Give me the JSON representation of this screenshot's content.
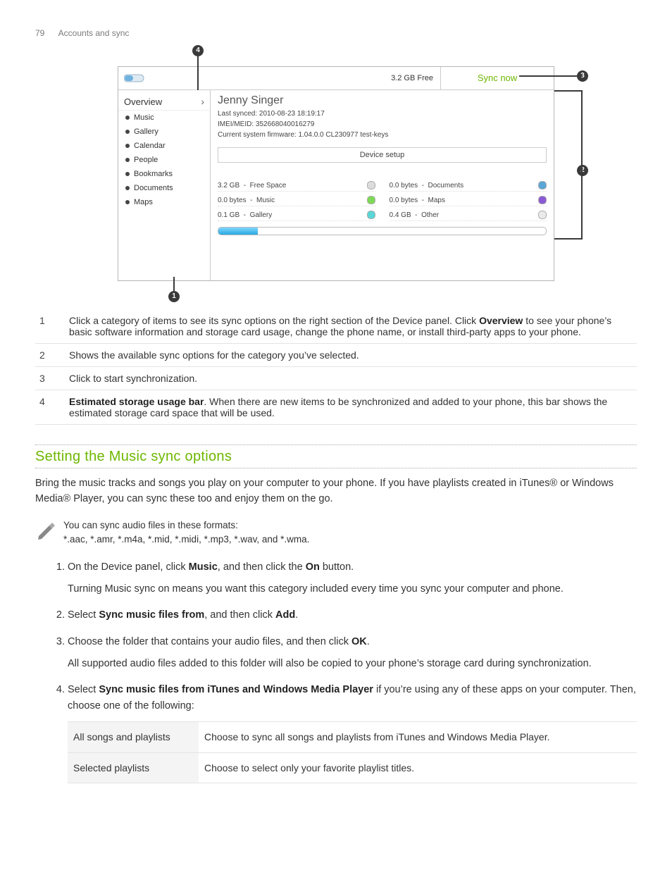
{
  "header": {
    "page": "79",
    "section": "Accounts and sync"
  },
  "callouts": {
    "c1": "1",
    "c2": "2",
    "c3": "3",
    "c4": "4"
  },
  "panel": {
    "free": "3.2 GB Free",
    "sync_now": "Sync now",
    "overview": "Overview",
    "side_items": [
      "Music",
      "Gallery",
      "Calendar",
      "People",
      "Bookmarks",
      "Documents",
      "Maps"
    ],
    "name": "Jenny Singer",
    "last_synced": "Last synced: 2010-08-23 18:19:17",
    "imei": "IMEI/MEID: 352668040016279",
    "firmware": "Current system firmware: 1.04.0.0 CL230977 test-keys",
    "device_setup": "Device setup",
    "storage": [
      {
        "size": "3.2 GB",
        "label": "Free Space",
        "color": "#dcdcdc"
      },
      {
        "size": "0.0 bytes",
        "label": "Documents",
        "color": "#5aa6d6"
      },
      {
        "size": "0.0 bytes",
        "label": "Music",
        "color": "#7ed957"
      },
      {
        "size": "0.0 bytes",
        "label": "Maps",
        "color": "#8a5ad6"
      },
      {
        "size": "0.1 GB",
        "label": "Gallery",
        "color": "#5ad6d6"
      },
      {
        "size": "0.4 GB",
        "label": "Other",
        "color": "#eaeaea"
      }
    ]
  },
  "legend": {
    "r1": {
      "n": "1",
      "t_a": "Click a category of items to see its sync options on the right section of the Device panel. Click ",
      "bold": "Overview",
      "t_b": " to see your phone’s basic software information and storage card usage, change the phone name, or install third-party apps to your phone."
    },
    "r2": {
      "n": "2",
      "t": "Shows the available sync options for the category you’ve selected."
    },
    "r3": {
      "n": "3",
      "t": "Click to start synchronization."
    },
    "r4": {
      "n": "4",
      "bold": "Estimated storage usage bar",
      "t": ". When there are new items to be synchronized and added to your phone, this bar shows the estimated storage card space that will be used."
    }
  },
  "h2": "Setting the Music sync options",
  "intro": "Bring the music tracks and songs you play on your computer to your phone. If you have playlists created in iTunes® or Windows Media® Player, you can sync these too and enjoy them on the go.",
  "note": {
    "l1": "You can sync audio files in these formats:",
    "l2": "*.aac, *.amr, *.m4a, *.mid, *.midi, *.mp3, *.wav, and *.wma."
  },
  "steps": {
    "s1": {
      "a": "On the Device panel, click ",
      "b1": "Music",
      "b": ", and then click the ",
      "b2": "On",
      "c": " button.",
      "sub": "Turning Music sync on means you want this category included every time you sync your computer and phone."
    },
    "s2": {
      "a": "Select ",
      "b1": "Sync music files from",
      "b": ", and then click ",
      "b2": "Add",
      "c": "."
    },
    "s3": {
      "a": "Choose the folder that contains your audio files, and then click ",
      "b1": "OK",
      "b": ".",
      "sub": "All supported audio files added to this folder will also be copied to your phone’s storage card during synchronization."
    },
    "s4": {
      "a": "Select ",
      "b1": "Sync music files from iTunes and Windows Media Player",
      "b": " if you’re using any of these apps on your computer. Then, choose one of the following:"
    }
  },
  "opts": {
    "o1": {
      "l": "All songs and playlists",
      "r": "Choose to sync all songs and playlists from iTunes and Windows Media Player."
    },
    "o2": {
      "l": "Selected playlists",
      "r": "Choose to select only your favorite playlist titles."
    }
  }
}
